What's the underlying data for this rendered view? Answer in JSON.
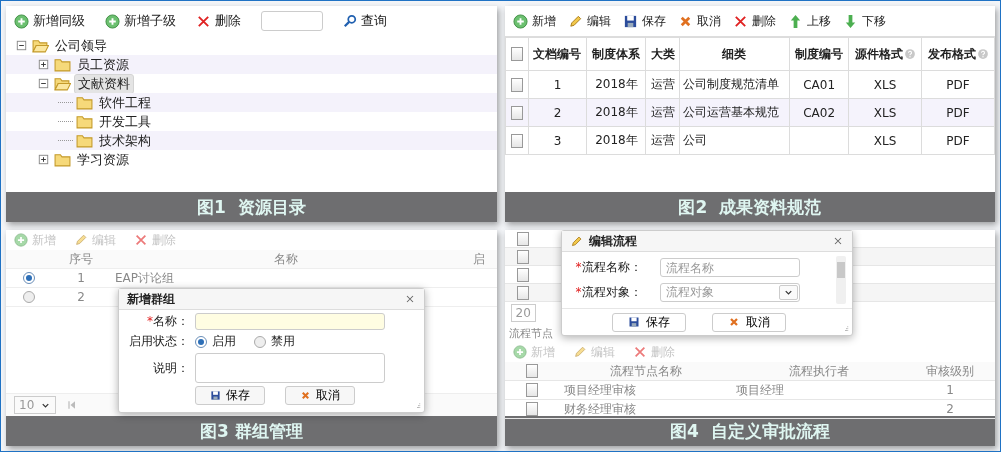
{
  "figure_1": {
    "toolbar": [
      {
        "kind": "add",
        "label": "新增同级"
      },
      {
        "kind": "add",
        "label": "新增子级"
      },
      {
        "kind": "delete",
        "label": "删除"
      }
    ],
    "search_button": "查询",
    "tree": [
      {
        "label": "公司领导",
        "kind": "branch",
        "expanded": true,
        "selected": false,
        "children": [
          {
            "label": "员工资源",
            "kind": "branch",
            "expanded": false,
            "selected": false
          },
          {
            "label": "文献资料",
            "kind": "branch",
            "expanded": true,
            "selected": true,
            "children": [
              {
                "label": "软件工程",
                "kind": "leaf",
                "selected": false
              },
              {
                "label": "开发工具",
                "kind": "leaf",
                "selected": false
              },
              {
                "label": "技术架构",
                "kind": "leaf",
                "selected": false
              }
            ]
          },
          {
            "label": "学习资源",
            "kind": "branch",
            "expanded": false,
            "selected": false
          }
        ]
      }
    ],
    "caption": "图1  资源目录"
  },
  "figure_2": {
    "toolbar": [
      {
        "kind": "add",
        "label": "新增"
      },
      {
        "kind": "edit",
        "label": "编辑"
      },
      {
        "kind": "save",
        "label": "保存"
      },
      {
        "kind": "cancel",
        "label": "取消"
      },
      {
        "kind": "delete",
        "label": "删除"
      },
      {
        "kind": "up",
        "label": "上移"
      },
      {
        "kind": "down",
        "label": "下移"
      }
    ],
    "select_all_checked": false,
    "columns": [
      {
        "label": "文档编号",
        "help": false
      },
      {
        "label": "制度体系",
        "help": false
      },
      {
        "label": "大类",
        "help": false
      },
      {
        "label": "细类",
        "help": false
      },
      {
        "label": "制度编号",
        "help": false
      },
      {
        "label": "源件格式",
        "help": true
      },
      {
        "label": "发布格式",
        "help": true
      }
    ],
    "rows": [
      {
        "checked": false,
        "cells": [
          "1",
          "2018年",
          "运营",
          "公司制度规范清单",
          "CA01",
          "XLS",
          "PDF"
        ]
      },
      {
        "checked": false,
        "cells": [
          "2",
          "2018年",
          "运营",
          "公司运营基本规范",
          "CA02",
          "XLS",
          "PDF"
        ]
      },
      {
        "checked": false,
        "cells": [
          "3",
          "2018年",
          "运营",
          "公司",
          null,
          "XLS",
          "PDF"
        ]
      }
    ],
    "caption": "图2  成果资料规范"
  },
  "figure_3": {
    "toolbar": [
      {
        "kind": "add",
        "label": "新增",
        "disabled": true
      },
      {
        "kind": "edit",
        "label": "编辑",
        "disabled": true
      },
      {
        "kind": "delete",
        "label": "删除",
        "disabled": true
      }
    ],
    "columns": [
      "序号",
      "名称",
      "启"
    ],
    "rows": [
      {
        "selected": true,
        "index": "1",
        "name": "EAP讨论组"
      },
      {
        "selected": false,
        "index": "2"
      }
    ],
    "pager": {
      "page_size": "10"
    },
    "dialog": {
      "title": "新增群组",
      "name_field": {
        "required_mark": "*",
        "label": "名称："
      },
      "status": {
        "label": "启用状态：",
        "options": [
          {
            "label": "启用",
            "selected": true
          },
          {
            "label": "禁用",
            "selected": false
          }
        ]
      },
      "description": {
        "label": "说明："
      },
      "buttons": [
        {
          "kind": "save",
          "label": "保存"
        },
        {
          "kind": "cancel",
          "label": "取消"
        }
      ]
    },
    "caption": "图3 群组管理"
  },
  "figure_4": {
    "background_rows": [
      {
        "checked": false
      },
      {
        "checked": false
      },
      {
        "checked": false
      },
      {
        "checked": false
      }
    ],
    "pager": {
      "page_size": "20"
    },
    "dialog": {
      "title": "编辑流程",
      "fields": [
        {
          "kind": "text",
          "required_mark": "*",
          "label": "流程名称：",
          "placeholder": "流程名称"
        },
        {
          "kind": "select",
          "required_mark": "*",
          "label": "流程对象：",
          "placeholder": "流程对象"
        }
      ],
      "buttons": [
        {
          "kind": "save",
          "label": "保存"
        },
        {
          "kind": "cancel",
          "label": "取消"
        }
      ]
    },
    "nodes": {
      "title": "流程节点",
      "toolbar": [
        {
          "kind": "add",
          "label": "新增",
          "disabled": true
        },
        {
          "kind": "edit",
          "label": "编辑",
          "disabled": true
        },
        {
          "kind": "delete",
          "label": "删除",
          "disabled": true
        }
      ],
      "select_all_checked": false,
      "columns": [
        "流程节点名称",
        "流程执行者",
        "审核级别"
      ],
      "rows": [
        {
          "checked": false,
          "name": "项目经理审核",
          "executor": "项目经理",
          "review_level": "1"
        },
        {
          "checked": false,
          "name": "财务经理审核",
          "review_level": "2"
        }
      ]
    },
    "caption": "图4  自定义审批流程"
  }
}
